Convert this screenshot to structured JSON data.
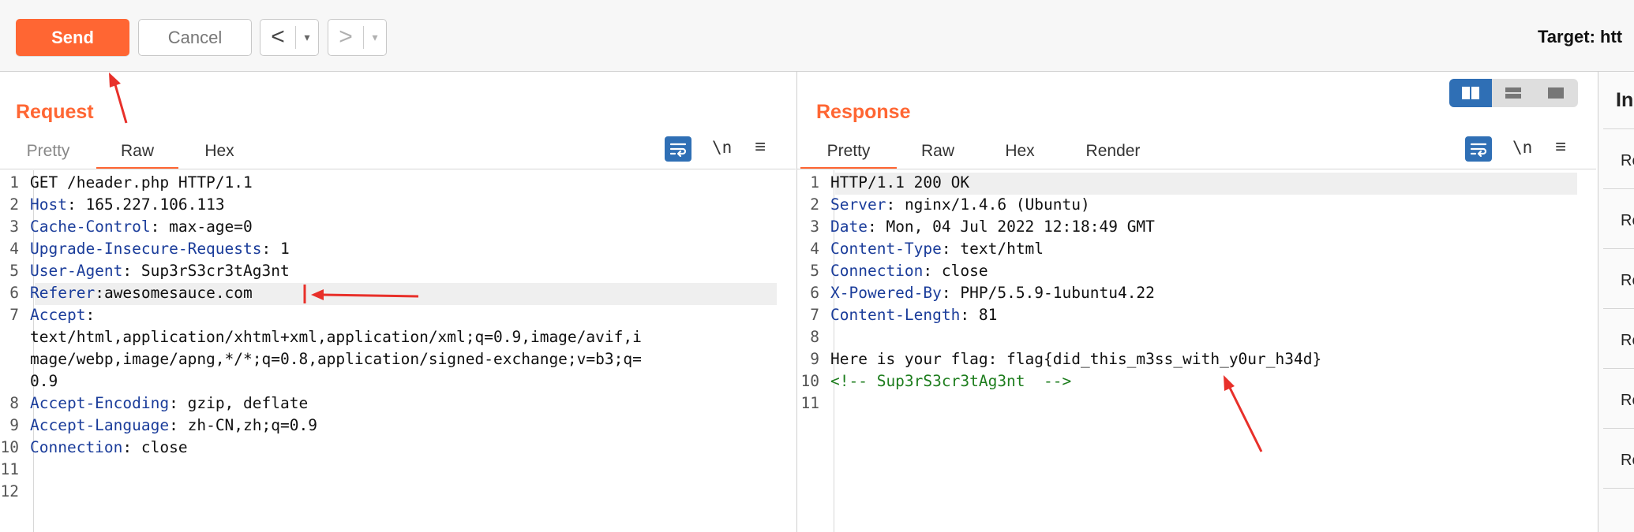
{
  "toolbar": {
    "send_label": "Send",
    "cancel_label": "Cancel",
    "back_glyph": "<",
    "forward_glyph": ">",
    "dropdown_glyph": "▾",
    "target_text": "Target: htt"
  },
  "request": {
    "title": "Request",
    "tabs": [
      "Pretty",
      "Raw",
      "Hex"
    ],
    "active_tab": "Raw",
    "newline_toggle": "\\n",
    "lines": [
      {
        "num": "1",
        "key": "",
        "sep": "",
        "value": "GET /header.php HTTP/1.1"
      },
      {
        "num": "2",
        "key": "Host",
        "sep": ": ",
        "value": "165.227.106.113"
      },
      {
        "num": "3",
        "key": "Cache-Control",
        "sep": ": ",
        "value": "max-age=0"
      },
      {
        "num": "4",
        "key": "Upgrade-Insecure-Requests",
        "sep": ": ",
        "value": "1"
      },
      {
        "num": "5",
        "key": "User-Agent",
        "sep": ": ",
        "value": "Sup3rS3cr3tAg3nt"
      },
      {
        "num": "6",
        "key": "Referer",
        "sep": ":",
        "value": "awesomesauce.com"
      },
      {
        "num": "7",
        "key": "Accept",
        "sep": ":",
        "value": ""
      },
      {
        "num": "",
        "key": "",
        "sep": "",
        "value": "text/html,application/xhtml+xml,application/xml;q=0.9,image/avif,i"
      },
      {
        "num": "",
        "key": "",
        "sep": "",
        "value": "mage/webp,image/apng,*/*;q=0.8,application/signed-exchange;v=b3;q="
      },
      {
        "num": "",
        "key": "",
        "sep": "",
        "value": "0.9"
      },
      {
        "num": "8",
        "key": "Accept-Encoding",
        "sep": ": ",
        "value": "gzip, deflate"
      },
      {
        "num": "9",
        "key": "Accept-Language",
        "sep": ": ",
        "value": "zh-CN,zh;q=0.9"
      },
      {
        "num": "10",
        "key": "Connection",
        "sep": ": ",
        "value": "close"
      },
      {
        "num": "11",
        "key": "",
        "sep": "",
        "value": ""
      },
      {
        "num": "12",
        "key": "",
        "sep": "",
        "value": ""
      }
    ]
  },
  "response": {
    "title": "Response",
    "tabs": [
      "Pretty",
      "Raw",
      "Hex",
      "Render"
    ],
    "active_tab": "Pretty",
    "newline_toggle": "\\n",
    "lines": [
      {
        "num": "1",
        "key": "",
        "sep": "",
        "value": "HTTP/1.1 200 OK"
      },
      {
        "num": "2",
        "key": "Server",
        "sep": ": ",
        "value": "nginx/1.4.6 (Ubuntu)"
      },
      {
        "num": "3",
        "key": "Date",
        "sep": ": ",
        "value": "Mon, 04 Jul 2022 12:18:49 GMT"
      },
      {
        "num": "4",
        "key": "Content-Type",
        "sep": ": ",
        "value": "text/html"
      },
      {
        "num": "5",
        "key": "Connection",
        "sep": ": ",
        "value": "close"
      },
      {
        "num": "6",
        "key": "X-Powered-By",
        "sep": ": ",
        "value": "PHP/5.5.9-1ubuntu4.22"
      },
      {
        "num": "7",
        "key": "Content-Length",
        "sep": ": ",
        "value": "81"
      },
      {
        "num": "8",
        "key": "",
        "sep": "",
        "value": ""
      },
      {
        "num": "9",
        "key": "",
        "sep": "",
        "value": "Here is your flag: flag{did_this_m3ss_with_y0ur_h34d}"
      },
      {
        "num": "10",
        "key": "",
        "sep": "",
        "value": "<!-- Sup3rS3cr3tAg3nt  -->",
        "comment": true
      },
      {
        "num": "11",
        "key": "",
        "sep": "",
        "value": ""
      }
    ]
  },
  "inspector": {
    "title": "In",
    "rows": [
      "Re",
      "Re",
      "Re",
      "Re",
      "Re",
      "Re"
    ]
  },
  "colors": {
    "accent": "#ff6633",
    "header_key": "#1a3c9a",
    "comment": "#1d7d1d",
    "toggle_blue": "#2f6fb5",
    "annotation_red": "#e8302a"
  }
}
